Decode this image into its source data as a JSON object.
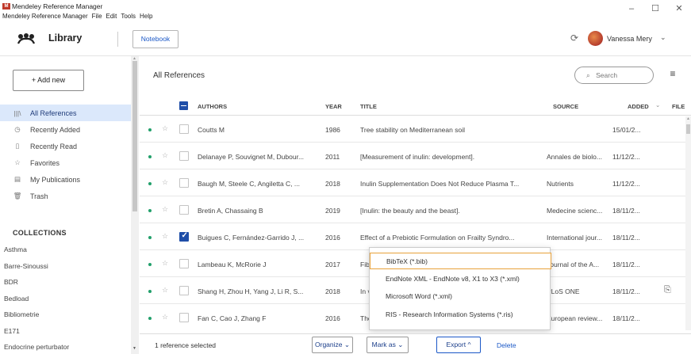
{
  "window": {
    "title": "Mendeley Reference Manager",
    "menu": [
      "Mendeley Reference Manager",
      "File",
      "Edit",
      "Tools",
      "Help"
    ],
    "controls": [
      "–",
      "☐",
      "✕"
    ],
    "logo_text": "M"
  },
  "header": {
    "library_label": "Library",
    "notebook_label": "Notebook",
    "user_name": "Vanessa Mery",
    "user_chevron": "⌄",
    "sync_icon": "⟳"
  },
  "sidebar": {
    "add_new_label": "+ Add new",
    "nav": [
      {
        "icon": "|||\\",
        "label": "All References"
      },
      {
        "icon": "◷",
        "label": "Recently Added"
      },
      {
        "icon": "▯",
        "label": "Recently Read"
      },
      {
        "icon": "☆",
        "label": "Favorites"
      },
      {
        "icon": "▤",
        "label": "My Publications"
      },
      {
        "icon": "🗑",
        "label": "Trash"
      }
    ],
    "collections_header": "COLLECTIONS",
    "collections": [
      "Asthma",
      "Barre-Sinoussi",
      "BDR",
      "Bedload",
      "Bibliometrie",
      "E171",
      "Endocrine perturbator"
    ]
  },
  "main": {
    "header_title": "All References",
    "search_placeholder": "Search",
    "search_icon": "⌕",
    "filter_icon": "≡",
    "columns": {
      "authors": "AUTHORS",
      "year": "YEAR",
      "title": "TITLE",
      "source": "SOURCE",
      "added": "ADDED",
      "added_sort": "⌄",
      "file": "FILE"
    },
    "rows": [
      {
        "authors": "Coutts M",
        "year": "1986",
        "title": "Tree stability on Mediterranean soil",
        "source": "",
        "added": "15/01/2...",
        "checked": false,
        "file": ""
      },
      {
        "authors": "Delanaye P, Souvignet M, Dubour...",
        "year": "2011",
        "title": "[Measurement of inulin: development].",
        "source": "Annales de biolo...",
        "added": "11/12/2...",
        "checked": false,
        "file": ""
      },
      {
        "authors": "Baugh M, Steele C, Angiletta C, ...",
        "year": "2018",
        "title": "Inulin Supplementation Does Not Reduce Plasma T...",
        "source": "Nutrients",
        "added": "11/12/2...",
        "checked": false,
        "file": ""
      },
      {
        "authors": "Bretin A, Chassaing B",
        "year": "2019",
        "title": "[Inulin: the beauty and the beast].",
        "source": "Medecine scienc...",
        "added": "18/11/2...",
        "checked": false,
        "file": ""
      },
      {
        "authors": "Buigues C, Fernández-Garrido J, ...",
        "year": "2016",
        "title": "Effect of a Prebiotic Formulation on Frailty Syndro...",
        "source": "International jour...",
        "added": "18/11/2...",
        "checked": true,
        "file": ""
      },
      {
        "authors": "Lambeau K, McRorie J",
        "year": "2017",
        "title": "Fiber supplements and clinically proven health be...",
        "source": "Journal of the A...",
        "added": "18/11/2...",
        "checked": false,
        "file": ""
      },
      {
        "authors": "Shang H, Zhou H, Yang J, Li R, S...",
        "year": "2018",
        "title": "In vitro and in vivo evaluation of inulin...",
        "source": "PLoS ONE",
        "added": "18/11/2...",
        "checked": false,
        "file": "⎘"
      },
      {
        "authors": "Fan C, Cao J, Zhang F",
        "year": "2016",
        "title": "The role of dietary fiber...",
        "source": "European review...",
        "added": "18/11/2...",
        "checked": false,
        "file": ""
      }
    ]
  },
  "footer": {
    "selected_text": "1 reference selected",
    "organize_label": "Organize ⌄",
    "mark_as_label": "Mark as ⌄",
    "export_label": "Export ^",
    "delete_label": "Delete"
  },
  "export_menu": {
    "items": [
      "BibTeX (*.bib)",
      "EndNote XML - EndNote v8, X1 to X3 (*.xml)",
      "Microsoft Word (*.xml)",
      "RIS - Research Information Systems (*.ris)"
    ]
  },
  "colors": {
    "accent": "#1f4ea8",
    "active_nav_bg": "#dbe8fb",
    "status_dot": "#22a06b",
    "menu_highlight": "#e8a13a"
  }
}
